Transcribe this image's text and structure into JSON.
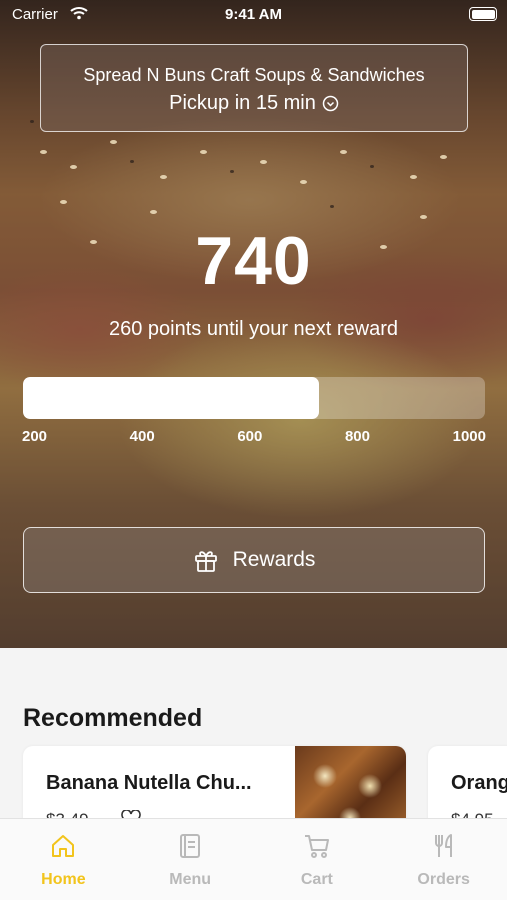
{
  "status_bar": {
    "carrier": "Carrier",
    "time": "9:41 AM"
  },
  "store": {
    "name": "Spread N Buns Craft Soups & Sandwiches",
    "pickup": "Pickup in 15 min"
  },
  "loyalty": {
    "points": "740",
    "until_text": "260 points until your next reward",
    "progress_fraction": 0.64,
    "ticks": [
      "200",
      "400",
      "600",
      "800",
      "1000"
    ],
    "rewards_label": "Rewards"
  },
  "recommended": {
    "title": "Recommended",
    "items": [
      {
        "title": "Banana Nutella Chu...",
        "price": "$3.49"
      },
      {
        "title": "Orang",
        "price": "$4.95"
      }
    ]
  },
  "tabs": [
    {
      "label": "Home",
      "icon": "home-icon",
      "active": true
    },
    {
      "label": "Menu",
      "icon": "menu-book-icon",
      "active": false
    },
    {
      "label": "Cart",
      "icon": "cart-icon",
      "active": false
    },
    {
      "label": "Orders",
      "icon": "fork-knife-icon",
      "active": false
    }
  ],
  "colors": {
    "accent": "#f2c41c",
    "tab_inactive": "#b9b9b9"
  }
}
